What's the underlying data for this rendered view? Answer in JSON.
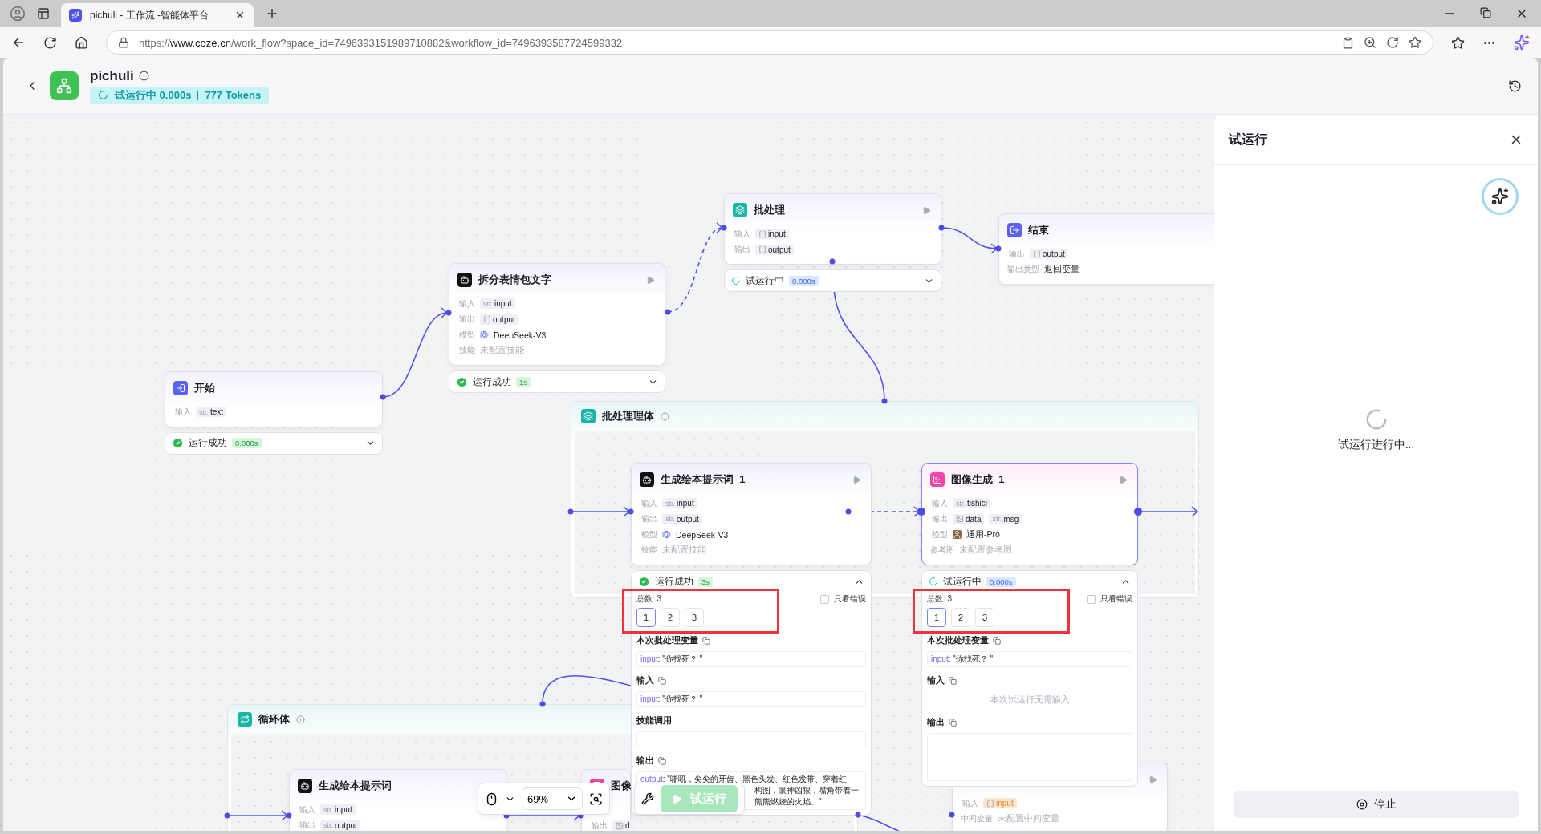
{
  "browser": {
    "tab_title": "pichuli - 工作流 -智能体平台",
    "url_scheme": "https://",
    "url_host": "www.coze.cn",
    "url_path": "/work_flow?space_id=7496393151989710882&workflow_id=7496393587724599332"
  },
  "header": {
    "title": "pichuli",
    "status": "试运行中 0.000s",
    "tokens": "777 Tokens"
  },
  "containers": [
    {
      "title": "批处理理体"
    },
    {
      "title": "循环体"
    }
  ],
  "nodes": [
    {
      "kind": "start",
      "title": "开始",
      "runnable": false,
      "selected": false,
      "rows": [
        {
          "label": "输入",
          "kind": "vars",
          "vars": [
            {
              "kind": "text",
              "prefix": "str.",
              "name": "text",
              "highlight": false
            }
          ]
        }
      ],
      "status": {
        "kind": "success",
        "label": "运行成功",
        "time": "0.000s",
        "expanded": false
      }
    },
    {
      "kind": "llm",
      "title": "拆分表情包文字",
      "runnable": true,
      "selected": false,
      "rows": [
        {
          "label": "输入",
          "kind": "vars",
          "vars": [
            {
              "kind": "text",
              "prefix": "str.",
              "name": "input",
              "highlight": false
            }
          ]
        },
        {
          "label": "输出",
          "kind": "vars",
          "vars": [
            {
              "kind": "array",
              "name": "output",
              "highlight": false
            }
          ]
        },
        {
          "label": "模型",
          "kind": "model",
          "text": "DeepSeek-V3"
        },
        {
          "label": "技能",
          "kind": "plain",
          "text": "未配置技能"
        }
      ],
      "status": {
        "kind": "success",
        "label": "运行成功",
        "time": "1s",
        "expanded": false
      }
    },
    {
      "kind": "batch",
      "title": "批处理",
      "runnable": true,
      "selected": false,
      "rows": [
        {
          "label": "输入",
          "kind": "vars",
          "vars": [
            {
              "kind": "array",
              "name": "input",
              "highlight": false
            }
          ]
        },
        {
          "label": "输出",
          "kind": "vars",
          "vars": [
            {
              "kind": "array",
              "name": "output",
              "highlight": false
            }
          ]
        }
      ],
      "status": {
        "kind": "running",
        "label": "试运行中",
        "time": "0.000s",
        "expanded": false
      }
    },
    {
      "kind": "end",
      "title": "结束",
      "runnable": false,
      "selected": false,
      "rows": [
        {
          "label": "输出",
          "kind": "vars",
          "vars": [
            {
              "kind": "array",
              "name": "output",
              "highlight": false
            }
          ]
        },
        {
          "label": "输出类型",
          "kind": "value",
          "text": "返回变量"
        }
      ]
    },
    {
      "kind": "llm",
      "title": "生成绘本提示词_1",
      "runnable": true,
      "selected": false,
      "rows": [
        {
          "label": "输入",
          "kind": "vars",
          "vars": [
            {
              "kind": "text",
              "prefix": "str.",
              "name": "input",
              "highlight": false
            }
          ]
        },
        {
          "label": "输出",
          "kind": "vars",
          "vars": [
            {
              "kind": "text",
              "prefix": "str.",
              "name": "output",
              "highlight": false
            }
          ]
        },
        {
          "label": "模型",
          "kind": "model",
          "text": "DeepSeek-V3"
        },
        {
          "label": "技能",
          "kind": "plain",
          "text": "未配置技能"
        }
      ],
      "status": {
        "kind": "success",
        "label": "运行成功",
        "time": "3s",
        "expanded": true,
        "panel": {
          "highlighted": true,
          "total": "总数: 3",
          "only_errors": {
            "label": "只看错误",
            "checked": false
          },
          "pages": [
            {
              "label": "1",
              "selected": true
            },
            {
              "label": "2",
              "selected": false
            },
            {
              "label": "3",
              "selected": false
            }
          ],
          "sections": [
            {
              "title": "本次批处理变量",
              "kind": "kv",
              "key": "input",
              "value": ": \"你找死？ \""
            },
            {
              "title": "输入",
              "kind": "kv",
              "key": "input",
              "value": ": \"你找死？ \""
            },
            {
              "title": "技能调用",
              "kind": "empty"
            },
            {
              "title": "输出",
              "kind": "lines",
              "key": "output",
              "lines": [
                ": \"嘶吼，尖尖的牙齿、黑色头发、红色发带、穿着红",
                "构图，眼神凶狠，嘴角带着一",
                "熊熊燃烧的火焰。\""
              ]
            }
          ]
        }
      }
    },
    {
      "kind": "image",
      "title": "图像生成_1",
      "runnable": true,
      "selected": true,
      "rows": [
        {
          "label": "输入",
          "kind": "vars",
          "vars": [
            {
              "kind": "text",
              "prefix": "str.",
              "name": "tishici",
              "highlight": false
            }
          ]
        },
        {
          "label": "输出",
          "kind": "vars",
          "vars": [
            {
              "kind": "image",
              "name": "data",
              "highlight": false
            },
            {
              "kind": "text",
              "prefix": "str.",
              "name": "msg",
              "highlight": false
            }
          ]
        },
        {
          "label": "模型",
          "kind": "model",
          "text": "通用-Pro"
        },
        {
          "label": "参考图",
          "kind": "plain",
          "text": "未配置参考图"
        }
      ],
      "status": {
        "kind": "running",
        "label": "试运行中",
        "time": "0.000s",
        "expanded": true,
        "panel": {
          "highlighted": true,
          "total": "总数: 3",
          "only_errors": {
            "label": "只看错误",
            "checked": false
          },
          "pages": [
            {
              "label": "1",
              "selected": true
            },
            {
              "label": "2",
              "selected": false
            },
            {
              "label": "3",
              "selected": false
            }
          ],
          "sections": [
            {
              "title": "本次批处理变量",
              "kind": "kv",
              "key": "input",
              "value": ": \"你找死？ \""
            },
            {
              "title": "输入",
              "kind": "note",
              "text": "本次试运行无需输入"
            },
            {
              "title": "输出",
              "kind": "empty"
            }
          ]
        }
      }
    },
    {
      "kind": "llm",
      "title": "生成绘本提示词",
      "runnable": false,
      "selected": false,
      "rows": [
        {
          "label": "输入",
          "kind": "vars",
          "vars": [
            {
              "kind": "text",
              "prefix": "str.",
              "name": "input",
              "highlight": false
            }
          ]
        },
        {
          "label": "输出",
          "kind": "vars",
          "vars": [
            {
              "kind": "text",
              "prefix": "str.",
              "name": "output",
              "highlight": false
            }
          ]
        }
      ]
    },
    {
      "kind": "image",
      "title": "图像",
      "runnable": false,
      "selected": false,
      "rows": [
        {
          "label": "输出",
          "kind": "vars",
          "vars": [
            {
              "kind": "image",
              "name": "d",
              "highlight": false
            }
          ]
        }
      ]
    },
    {
      "kind": "hidden",
      "runnable": true,
      "selected": false,
      "rows": [
        {
          "label": "输入",
          "kind": "vars",
          "vars": [
            {
              "kind": "array",
              "name": "input",
              "highlight": true
            }
          ]
        },
        {
          "label": "中间变量",
          "kind": "plain",
          "text": "未配置中间变量"
        }
      ]
    }
  ],
  "toolbar": {
    "zoom": "69%",
    "run_label": "试运行",
    "run_disabled": true
  },
  "side_panel": {
    "title": "试运行",
    "loading_text": "试运行进行中...",
    "stop_label": "停止"
  }
}
